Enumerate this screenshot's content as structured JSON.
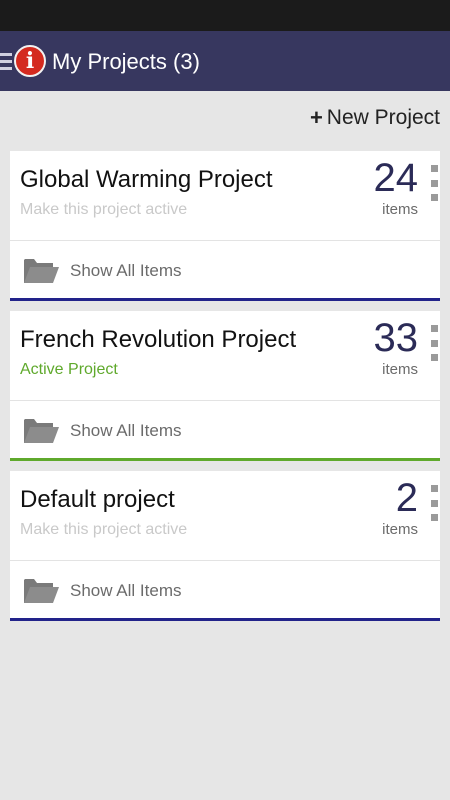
{
  "app_bar": {
    "title": "My Projects (3)"
  },
  "toolbar": {
    "new_project_label": "New Project",
    "new_project_icon": "+"
  },
  "projects": [
    {
      "name": "Global Warming Project",
      "status": "Make this project active",
      "count": "24",
      "count_label": "items",
      "show_all_label": "Show All Items",
      "active": false
    },
    {
      "name": "French Revolution Project",
      "status": "Active Project",
      "count": "33",
      "count_label": "items",
      "show_all_label": "Show All Items",
      "active": true
    },
    {
      "name": "Default project",
      "status": "Make this project active",
      "count": "2",
      "count_label": "items",
      "show_all_label": "Show All Items",
      "active": false
    }
  ],
  "colors": {
    "app_bar": "#37375f",
    "status_bar": "#1b1b1b",
    "background": "#e6e6e6",
    "inactive_accent": "#22238a",
    "active_accent": "#5fa92c",
    "logo": "#d42a1f"
  },
  "icons": {
    "menu": "hamburger-icon",
    "logo": "info-logo-icon",
    "add": "plus-icon",
    "overflow": "overflow-menu-icon",
    "folder": "folder-icon"
  }
}
